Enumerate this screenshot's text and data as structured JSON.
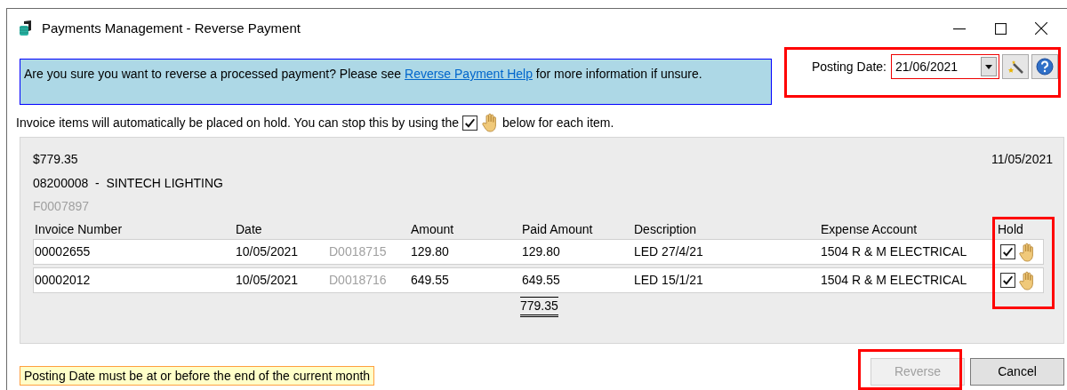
{
  "window": {
    "title": "Payments Management - Reverse Payment"
  },
  "banner": {
    "text_before": "Are you sure you want to reverse a processed payment?  Please see",
    "link": "Reverse Payment Help",
    "text_after": "for more information if unsure."
  },
  "posting_date": {
    "label": "Posting Date:",
    "value": "21/06/2021"
  },
  "instruction": {
    "text_before": "Invoice items will automatically be placed on hold. You can stop this by using the",
    "checked": true,
    "text_after": "below for each item."
  },
  "payment": {
    "amount": "$779.35",
    "date": "11/05/2021",
    "vendor": "08200008  -  SINTECH LIGHTING",
    "reference": "F0007897"
  },
  "table": {
    "columns": [
      "Invoice Number",
      "Date",
      "",
      "Amount",
      "Paid Amount",
      "Description",
      "Expense Account",
      "Hold"
    ],
    "rows": [
      {
        "invoice": "00002655",
        "date": "10/05/2021",
        "document": "D0018715",
        "amount": "129.80",
        "paid": "129.80",
        "description": "LED 27/4/21",
        "account": "1504 R & M ELECTRICAL",
        "hold": true
      },
      {
        "invoice": "00002012",
        "date": "10/05/2021",
        "document": "D0018716",
        "amount": "649.55",
        "paid": "649.55",
        "description": "LED 15/1/21",
        "account": "1504 R & M ELECTRICAL",
        "hold": true
      }
    ],
    "total": "779.35"
  },
  "warning": "Posting Date must be at or before the end of the current month",
  "buttons": [
    {
      "label": "Reverse",
      "disabled": true
    },
    {
      "label": "Cancel",
      "disabled": false
    }
  ]
}
